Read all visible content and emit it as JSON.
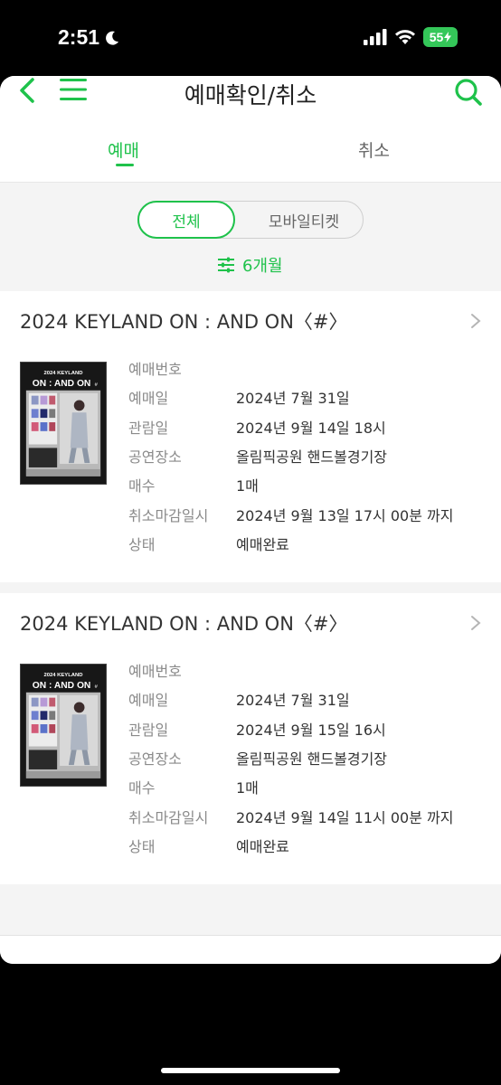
{
  "status_bar": {
    "time": "2:51",
    "battery": "55"
  },
  "header": {
    "title": "예매확인/취소"
  },
  "tabs": {
    "booking": "예매",
    "cancel": "취소"
  },
  "filter": {
    "all": "전체",
    "mobile": "모바일티켓",
    "period": "6개월"
  },
  "colors": {
    "accent": "#1fc24b",
    "text": "#333333",
    "label": "#8a8a8a",
    "background": "#f4f4f4"
  },
  "labels": {
    "booking_number": "예매번호",
    "booking_date": "예매일",
    "viewing_date": "관람일",
    "venue": "공연장소",
    "quantity": "매수",
    "cancel_deadline": "취소마감일시",
    "status": "상태"
  },
  "bookings": [
    {
      "title": "2024 KEYLAND ON : AND ON〈#〉",
      "poster": {
        "year_title": "2024 KEYLAND",
        "main_title": "ON : AND ON",
        "mark": "#"
      },
      "booking_number": "",
      "booking_date": "2024년 7월 31일",
      "viewing_date": "2024년 9월 14일 18시",
      "venue": "올림픽공원 핸드볼경기장",
      "quantity": "1매",
      "cancel_deadline": "2024년 9월 13일 17시 00분 까지",
      "status": "예매완료"
    },
    {
      "title": "2024 KEYLAND ON : AND ON〈#〉",
      "poster": {
        "year_title": "2024 KEYLAND",
        "main_title": "ON : AND ON",
        "mark": "#"
      },
      "booking_number": "",
      "booking_date": "2024년 7월 31일",
      "viewing_date": "2024년 9월 15일 16시",
      "venue": "올림픽공원 핸드볼경기장",
      "quantity": "1매",
      "cancel_deadline": "2024년 9월 14일 11시 00분 까지",
      "status": "예매완료"
    }
  ]
}
